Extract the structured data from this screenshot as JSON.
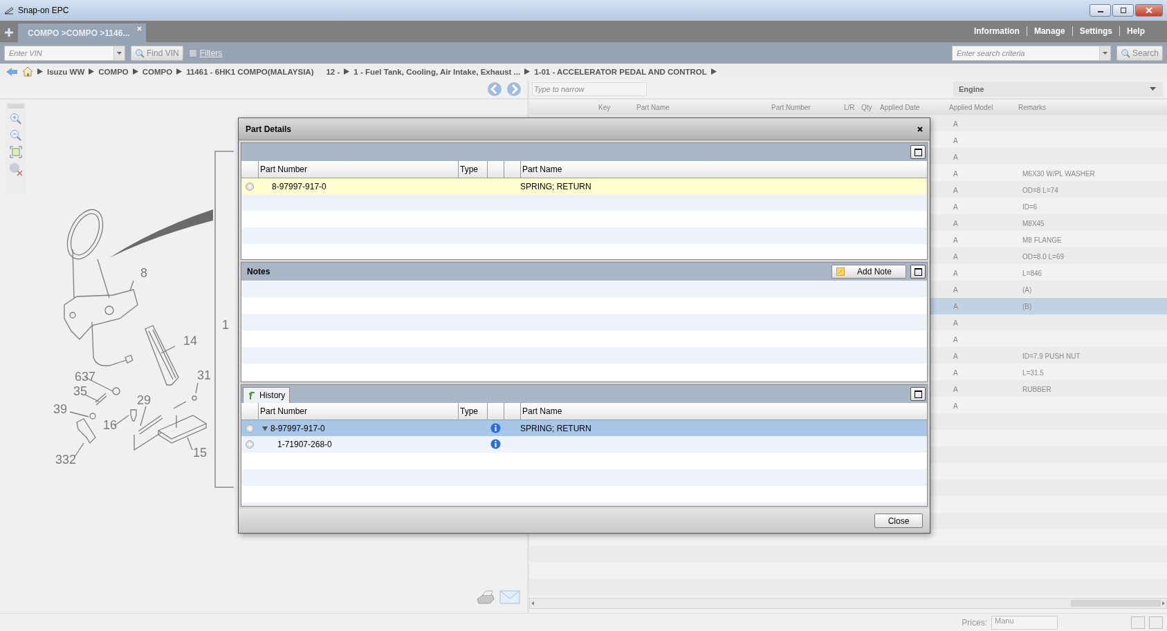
{
  "window": {
    "title": "Snap-on EPC"
  },
  "tabs": [
    {
      "label": "COMPO >COMPO >1146...",
      "selected": true
    }
  ],
  "top_menu": [
    "Information",
    "Manage",
    "Settings",
    "Help"
  ],
  "toolbar": {
    "vin_field": {
      "placeholder": "Enter VIN"
    },
    "find_vin": "Find VIN",
    "filters": {
      "label": "Filters",
      "checked": false
    },
    "search_field": {
      "placeholder": "Enter search criteria"
    },
    "search": "Search"
  },
  "breadcrumb": [
    {
      "label": "Isuzu WW",
      "arrow": true
    },
    {
      "label": "COMPO",
      "arrow": true
    },
    {
      "label": "COMPO",
      "arrow": true
    },
    {
      "label": "11461 - 6HK1 COMPO(MALAYSIA)",
      "arrow": true
    },
    {
      "label": "12 -",
      "arrow": false
    },
    {
      "label": "1 - Fuel Tank, Cooling, Air Intake, Exhaust ...",
      "arrow": true
    },
    {
      "label": "1-01 - ACCELERATOR PEDAL AND CONTROL",
      "arrow": true
    }
  ],
  "diagram": {
    "callouts": [
      "8",
      "14",
      "637",
      "35",
      "39",
      "16",
      "29",
      "31",
      "15",
      "332",
      "1"
    ]
  },
  "narrow_field": {
    "placeholder": "Type to narrow"
  },
  "group_select": {
    "value": "Engine"
  },
  "parts_table": {
    "columns": [
      "Key",
      "Part Name",
      "Part Number",
      "L/R",
      "Qty",
      "Applied Date",
      "Applied Model",
      "Remarks"
    ],
    "rows": [
      {
        "applied_model": "A",
        "selected": false
      },
      {
        "applied_model": "A",
        "selected": false
      },
      {
        "applied_model": "A",
        "selected": false
      },
      {
        "applied_model": "A",
        "remarks": "M6X30 W/PL WASHER",
        "selected": false
      },
      {
        "applied_model": "A",
        "remarks": "OD=8 L=74",
        "selected": false
      },
      {
        "applied_model": "A",
        "remarks": "ID=6",
        "selected": false
      },
      {
        "applied_model": "A",
        "remarks": "M8X45",
        "selected": false
      },
      {
        "applied_model": "A",
        "remarks": "M8 FLANGE",
        "selected": false
      },
      {
        "applied_model": "A",
        "remarks": "OD=8.0 L=69",
        "selected": false
      },
      {
        "applied_model": "A",
        "remarks": "L=846",
        "selected": false
      },
      {
        "applied_model": "A",
        "remarks": "(A)",
        "selected": false
      },
      {
        "applied_model": "A",
        "remarks": "(B)",
        "selected": true
      },
      {
        "applied_model": "A",
        "selected": false
      },
      {
        "applied_model": "A",
        "selected": false
      },
      {
        "applied_model": "A",
        "remarks": "ID=7.9 PUSH NUT",
        "selected": false
      },
      {
        "applied_model": "A",
        "remarks": "L=31.5",
        "selected": false
      },
      {
        "applied_model": "A",
        "remarks": "RUBBER",
        "selected": false
      },
      {
        "applied_model": "A",
        "selected": false
      }
    ]
  },
  "status_bar": {
    "prices_label": "Prices:",
    "prices_value": "Manu"
  },
  "dialog": {
    "title": "Part Details",
    "details": {
      "columns": [
        "Part Number",
        "Type",
        "Part Name"
      ],
      "rows": [
        {
          "part_number": "8-97997-917-0",
          "part_name": "SPRING; RETURN",
          "selected": true
        }
      ]
    },
    "notes": {
      "title": "Notes",
      "add_note": "Add Note"
    },
    "history": {
      "tab": "History",
      "columns": [
        "Part Number",
        "Type",
        "Part Name"
      ],
      "rows": [
        {
          "part_number": "8-97997-917-0",
          "part_name": "SPRING; RETURN",
          "selected": true,
          "expanded": true,
          "children": [
            {
              "part_number": "1-71907-268-0",
              "selected": false
            }
          ]
        }
      ]
    },
    "close": "Close"
  }
}
